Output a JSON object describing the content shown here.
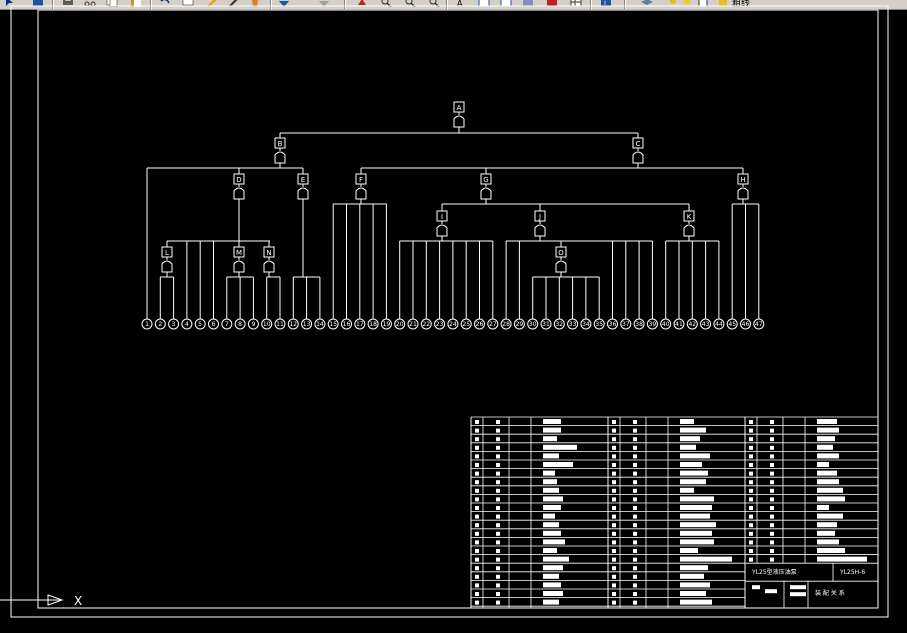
{
  "toolbar": {
    "label": "粗线",
    "icons": [
      "pointer-icon",
      "save-icon",
      "print-icon",
      "cut-icon",
      "copy-icon",
      "paste-icon",
      "undo-icon",
      "zoom-in-icon",
      "zoom-out-icon",
      "properties-icon",
      "help-icon",
      "layer-icon"
    ]
  },
  "drawing": {
    "title_block_name": "YL25型液压油泵",
    "drawing_code": "YL25H-6",
    "org": "装 配 关 系"
  },
  "tree": {
    "top": {
      "id": "A",
      "label": "A"
    },
    "level2": [
      {
        "id": "B",
        "label": "B"
      },
      {
        "id": "C",
        "label": "C"
      }
    ],
    "level3": [
      {
        "id": "D",
        "label": "D"
      },
      {
        "id": "E",
        "label": "E"
      },
      {
        "id": "F",
        "label": "F"
      },
      {
        "id": "G",
        "label": "G"
      },
      {
        "id": "H",
        "label": "H"
      }
    ],
    "level4": [
      {
        "id": "I",
        "label": "I"
      },
      {
        "id": "J",
        "label": "J"
      },
      {
        "id": "K",
        "label": "K"
      }
    ],
    "level5": [
      {
        "id": "L",
        "label": "L"
      },
      {
        "id": "M",
        "label": "M"
      },
      {
        "id": "N",
        "label": "N"
      },
      {
        "id": "O",
        "label": "O"
      }
    ],
    "leaves": [
      "1",
      "2",
      "3",
      "4",
      "5",
      "6",
      "7",
      "8",
      "9",
      "10",
      "11",
      "12",
      "13",
      "14",
      "15",
      "16",
      "17",
      "18",
      "19",
      "20",
      "21",
      "22",
      "23",
      "24",
      "25",
      "26",
      "27",
      "28",
      "29",
      "30",
      "31",
      "32",
      "33",
      "34",
      "35",
      "36",
      "37",
      "38",
      "39",
      "40",
      "41",
      "42",
      "43",
      "44",
      "45",
      "46",
      "47"
    ]
  },
  "axis": {
    "x_label": "X"
  }
}
